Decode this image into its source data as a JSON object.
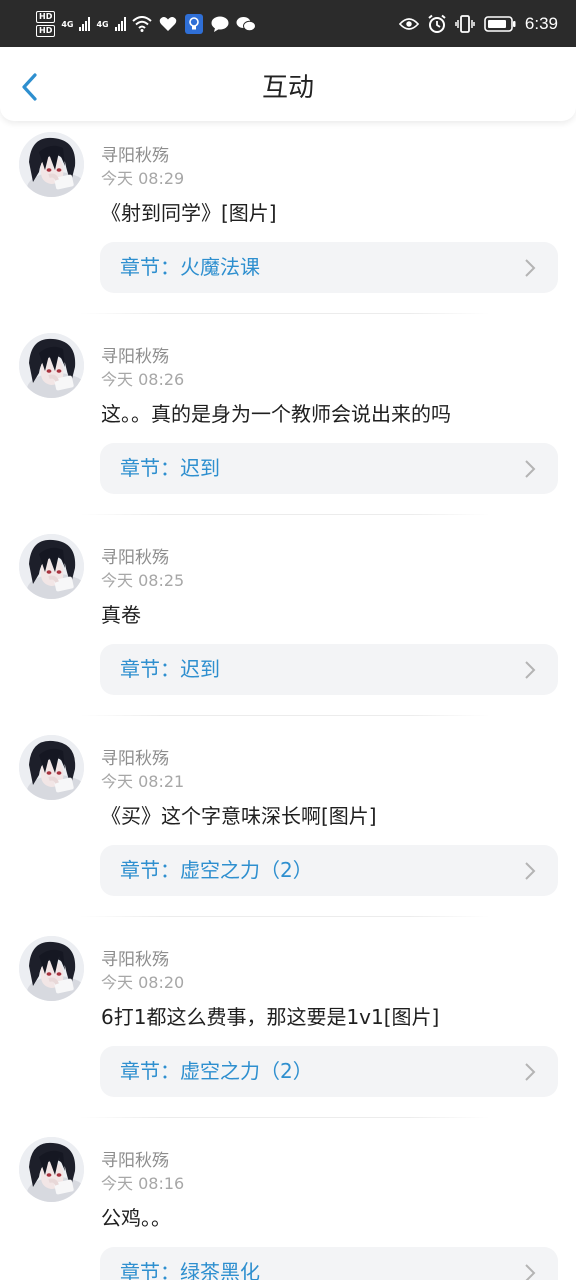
{
  "status_bar": {
    "hd1": "HD",
    "hd2": "HD",
    "net1": "4G",
    "net2": "4G",
    "time": "6:39"
  },
  "header": {
    "title": "互动",
    "back_icon": "chevron-left-icon",
    "accent_color": "#2e8fcf"
  },
  "comments": [
    {
      "user": "寻阳秋殇",
      "time": "今天 08:29",
      "content": "《射到同学》[图片]",
      "chapter": "章节：火魔法课"
    },
    {
      "user": "寻阳秋殇",
      "time": "今天 08:26",
      "content": "这。。真的是身为一个教师会说出来的吗",
      "chapter": "章节：迟到"
    },
    {
      "user": "寻阳秋殇",
      "time": "今天 08:25",
      "content": "真卷",
      "chapter": "章节：迟到"
    },
    {
      "user": "寻阳秋殇",
      "time": "今天 08:21",
      "content": "《买》这个字意味深长啊[图片]",
      "chapter": "章节：虚空之力（2）"
    },
    {
      "user": "寻阳秋殇",
      "time": "今天 08:20",
      "content": "6打1都这么费事，那这要是1v1[图片]",
      "chapter": "章节：虚空之力（2）"
    },
    {
      "user": "寻阳秋殇",
      "time": "今天 08:16",
      "content": "公鸡。。",
      "chapter": "章节：绿茶黑化"
    }
  ]
}
